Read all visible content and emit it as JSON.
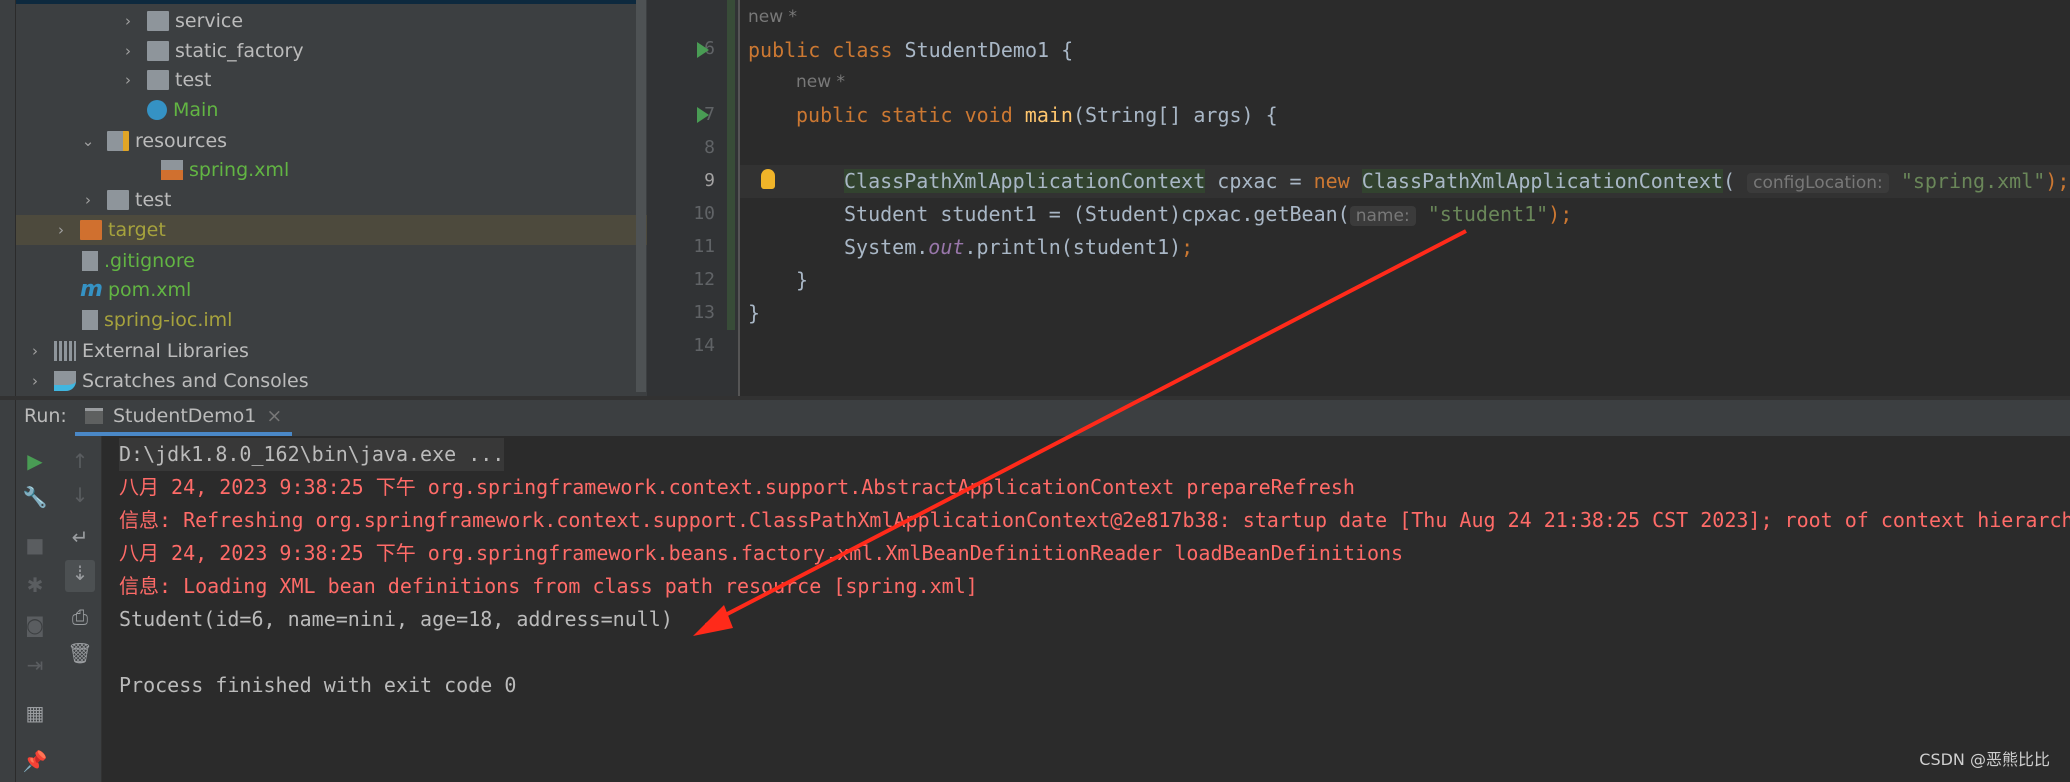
{
  "project_tree": {
    "items": [
      {
        "label": "service",
        "type": "package",
        "expanded": false
      },
      {
        "label": "static_factory",
        "type": "package",
        "expanded": false
      },
      {
        "label": "test",
        "type": "package",
        "expanded": false
      },
      {
        "label": "Main",
        "type": "class"
      },
      {
        "label": "resources",
        "type": "resources-folder",
        "expanded": true
      },
      {
        "label": "spring.xml",
        "type": "spring-xml"
      },
      {
        "label": "test",
        "type": "folder",
        "expanded": false
      },
      {
        "label": "target",
        "type": "excluded-folder",
        "expanded": false,
        "selected": true
      },
      {
        "label": ".gitignore",
        "type": "ignore-file"
      },
      {
        "label": "pom.xml",
        "type": "maven"
      },
      {
        "label": "spring-ioc.iml",
        "type": "iml"
      },
      {
        "label": "External Libraries",
        "type": "libraries",
        "expanded": false
      },
      {
        "label": "Scratches and Consoles",
        "type": "scratches",
        "expanded": false
      }
    ]
  },
  "editor": {
    "author_hint": "new *",
    "line_numbers": [
      "6",
      "7",
      "8",
      "9",
      "10",
      "11",
      "12",
      "13",
      "14"
    ],
    "code": {
      "l6": {
        "kw": "public class ",
        "name": "StudentDemo1 {"
      },
      "l7": {
        "kw": "public static void ",
        "method": "main",
        "rest": "(String[] args) {"
      },
      "l9": {
        "type": "ClassPathXmlApplicationContext",
        "var": " cpxac = ",
        "kw": "new ",
        "ctor": "ClassPathXmlApplicationContext",
        "paren": "(",
        "hint": "configLocation:",
        "str": "\"spring.xml\"",
        "end": ");"
      },
      "l10": {
        "pre": "Student student1 = (Student)cpxac.getBean(",
        "hint": "name:",
        "str": "\"student1\"",
        "end": ");"
      },
      "l11": {
        "pre": "System.",
        "field": "out",
        "rest": ".println(student1)",
        "semi": ";"
      },
      "l12": "}",
      "l13": "}"
    }
  },
  "run": {
    "label": "Run:",
    "tab": "StudentDemo1",
    "console": [
      {
        "text": "D:\\jdk1.8.0_162\\bin\\java.exe ...",
        "style": "cmd"
      },
      {
        "text": "八月 24, 2023 9:38:25 下午 org.springframework.context.support.AbstractApplicationContext prepareRefresh",
        "style": "err"
      },
      {
        "text": "信息: Refreshing org.springframework.context.support.ClassPathXmlApplicationContext@2e817b38: startup date [Thu Aug 24 21:38:25 CST 2023]; root of context hierarchy",
        "style": "err"
      },
      {
        "text": "八月 24, 2023 9:38:25 下午 org.springframework.beans.factory.xml.XmlBeanDefinitionReader loadBeanDefinitions",
        "style": "err"
      },
      {
        "text": "信息: Loading XML bean definitions from class path resource [spring.xml]",
        "style": "err"
      },
      {
        "text": "Student(id=6, name=nini, age=18, address=null)",
        "style": "out"
      },
      {
        "text": "",
        "style": "out"
      },
      {
        "text": "Process finished with exit code 0",
        "style": "out"
      }
    ]
  },
  "annotation_color": "#ff2a1a",
  "watermark": "CSDN @恶熊比比"
}
